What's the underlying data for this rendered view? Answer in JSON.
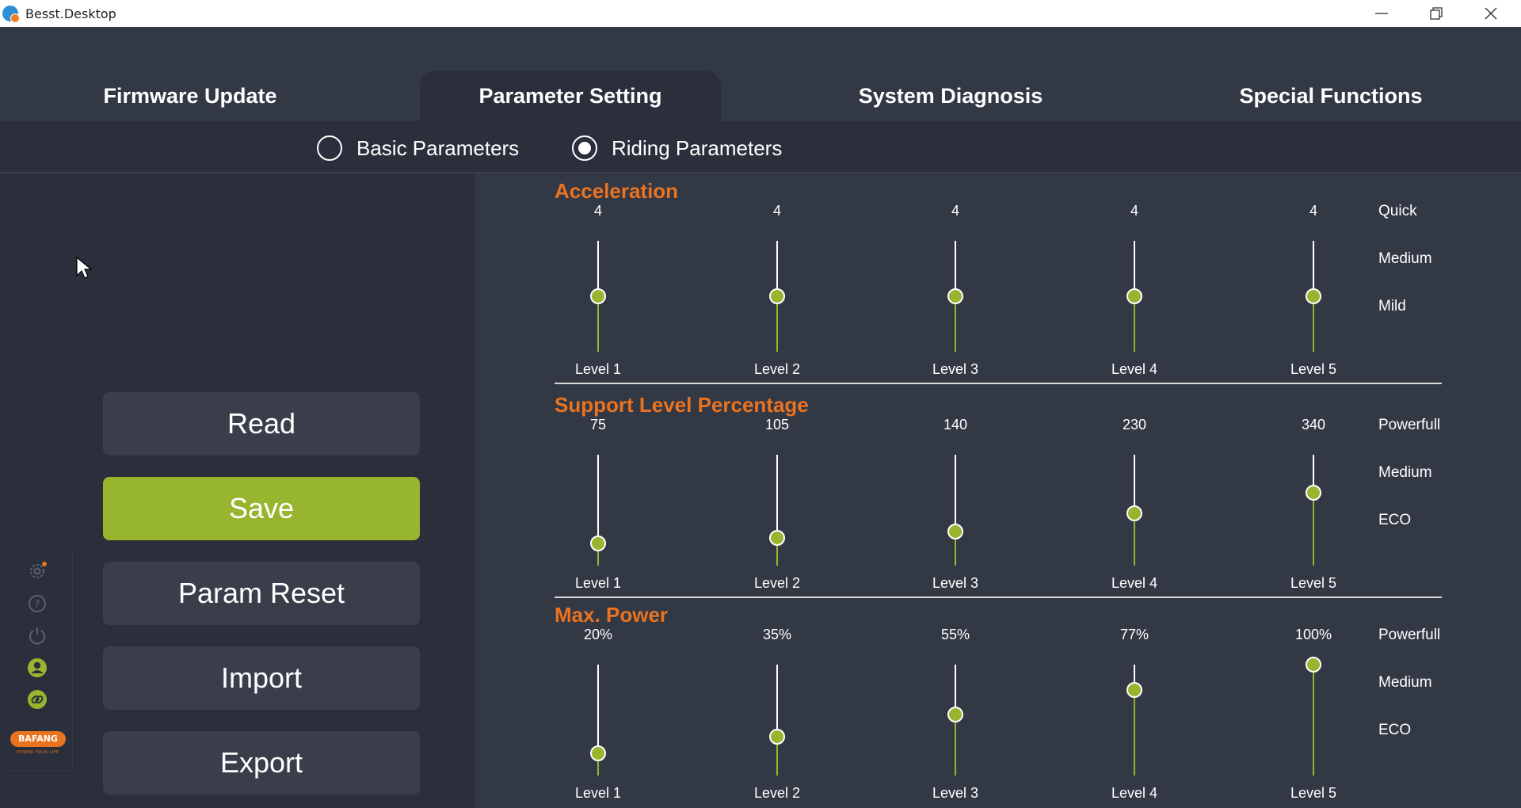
{
  "window": {
    "title": "Besst.Desktop",
    "controls": {
      "minimize": "minimize-icon",
      "maximize": "restore-icon",
      "close": "close-icon"
    }
  },
  "tabs": [
    {
      "label": "Firmware Update",
      "active": false
    },
    {
      "label": "Parameter Setting",
      "active": true
    },
    {
      "label": "System Diagnosis",
      "active": false
    },
    {
      "label": "Special Functions",
      "active": false
    }
  ],
  "subtabs": [
    {
      "label": "Basic Parameters",
      "selected": false
    },
    {
      "label": "Riding Parameters",
      "selected": true
    }
  ],
  "actions": {
    "read": "Read",
    "save": "Save",
    "reset": "Param Reset",
    "import": "Import",
    "export": "Export"
  },
  "sidebar": {
    "tools": [
      "settings-icon",
      "help-icon",
      "power-icon",
      "user-icon",
      "link-icon"
    ],
    "brand": "BAFANG",
    "tagline": "POWER YOUR LIFE"
  },
  "sections": [
    {
      "title": "Acceleration",
      "scale": [
        "Quick",
        "Medium",
        "Mild"
      ],
      "sliders": [
        {
          "label": "Level 1",
          "value": "4",
          "level": 0.5
        },
        {
          "label": "Level 2",
          "value": "4",
          "level": 0.5
        },
        {
          "label": "Level 3",
          "value": "4",
          "level": 0.5
        },
        {
          "label": "Level 4",
          "value": "4",
          "level": 0.5
        },
        {
          "label": "Level 5",
          "value": "4",
          "level": 0.5
        }
      ]
    },
    {
      "title": "Support Level Percentage",
      "scale": [
        "Powerfull",
        "Medium",
        "ECO"
      ],
      "sliders": [
        {
          "label": "Level 1",
          "value": "75",
          "level": 0.2
        },
        {
          "label": "Level 2",
          "value": "105",
          "level": 0.25
        },
        {
          "label": "Level 3",
          "value": "140",
          "level": 0.31
        },
        {
          "label": "Level 4",
          "value": "230",
          "level": 0.47
        },
        {
          "label": "Level 5",
          "value": "340",
          "level": 0.66
        }
      ]
    },
    {
      "title": "Max. Power",
      "scale": [
        "Powerfull",
        "Medium",
        "ECO"
      ],
      "sliders": [
        {
          "label": "Level 1",
          "value": "20%",
          "level": 0.2
        },
        {
          "label": "Level 2",
          "value": "35%",
          "level": 0.35
        },
        {
          "label": "Level 3",
          "value": "55%",
          "level": 0.55
        },
        {
          "label": "Level 4",
          "value": "77%",
          "level": 0.77
        },
        {
          "label": "Level 5",
          "value": "100%",
          "level": 1.0
        }
      ]
    }
  ],
  "colors": {
    "accent": "#97b52f",
    "section_title": "#e9731f",
    "background": "#2a2f3b",
    "panel": "#333845"
  }
}
